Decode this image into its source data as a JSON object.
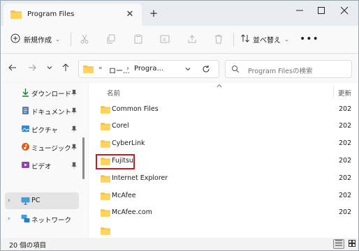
{
  "window": {
    "tab_title": "Program Files",
    "new_tab_symbol": "+",
    "tab_close_symbol": "✕"
  },
  "toolbar": {
    "new_label": "新規作成",
    "sort_label": "並べ替え",
    "more_symbol": "•••"
  },
  "address": {
    "overflow_symbol": "«",
    "crumbs": [
      "ロー...",
      "Progra..."
    ],
    "crumb_separator": "›",
    "search_placeholder": "Program Filesの検索"
  },
  "sidebar": {
    "items": [
      {
        "label": "ダウンロード",
        "icon": "download-icon",
        "pinned": true
      },
      {
        "label": "ドキュメント",
        "icon": "document-icon",
        "pinned": true
      },
      {
        "label": "ピクチャ",
        "icon": "picture-icon",
        "pinned": true
      },
      {
        "label": "ミュージック",
        "icon": "music-icon",
        "pinned": true
      },
      {
        "label": "ビデオ",
        "icon": "video-icon",
        "pinned": true
      },
      {
        "label": "PC",
        "icon": "pc-icon",
        "selected": true,
        "expandable": true
      },
      {
        "label": "ネットワーク",
        "icon": "network-icon",
        "expandable": true
      }
    ]
  },
  "content": {
    "column_name": "名前",
    "column_date": "更新",
    "files": [
      {
        "name": "Common Files",
        "date": "202"
      },
      {
        "name": "Corel",
        "date": "202"
      },
      {
        "name": "CyberLink",
        "date": "202"
      },
      {
        "name": "Fujitsu",
        "date": "202",
        "highlighted": true
      },
      {
        "name": "Internet Explorer",
        "date": "202"
      },
      {
        "name": "McAfee",
        "date": "202"
      },
      {
        "name": "McAfee.com",
        "date": "202"
      }
    ]
  },
  "status": {
    "item_count": "20 個の項目"
  },
  "colors": {
    "folder": "#f4c14a",
    "accent": "#0f6cbd",
    "highlight_border": "#d4141c"
  }
}
